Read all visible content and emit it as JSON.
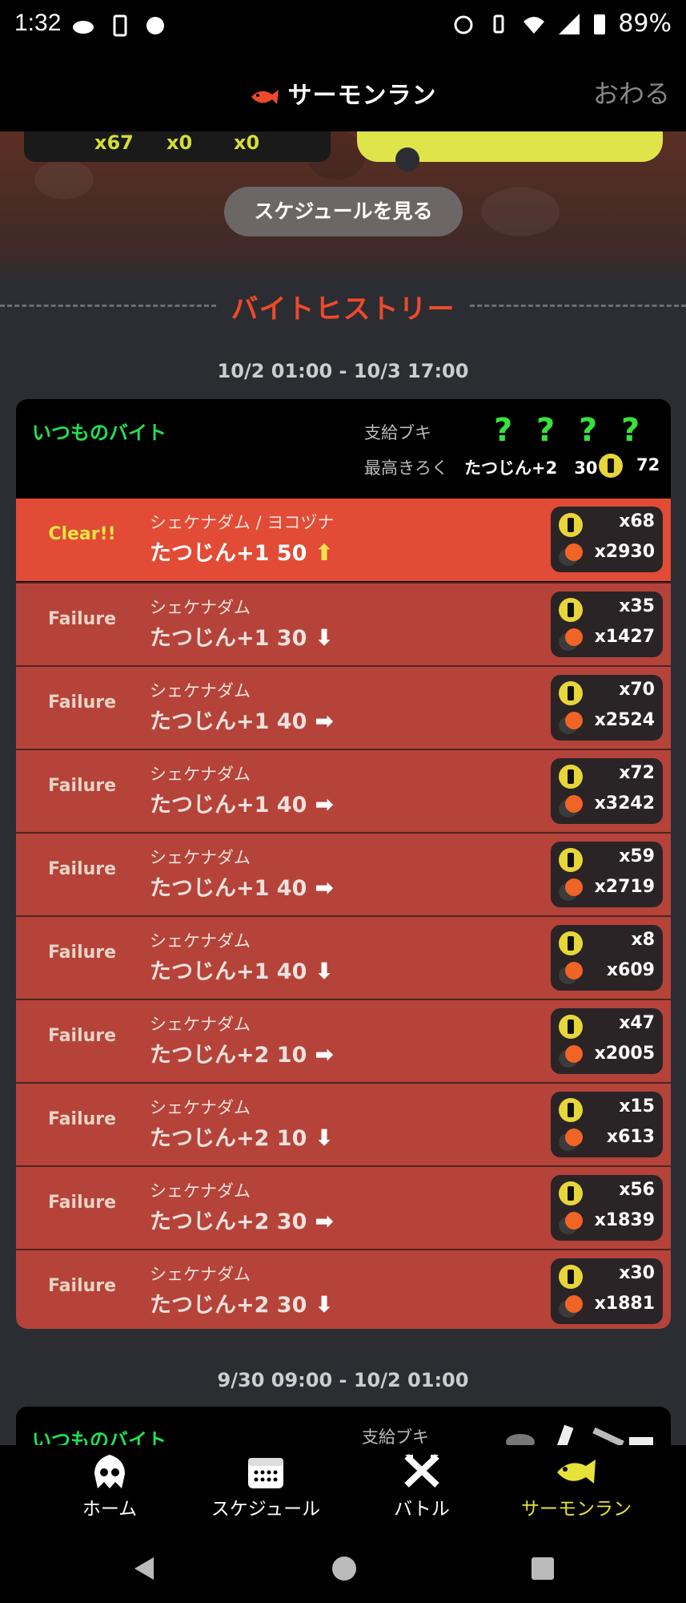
{
  "status_bar": {
    "time": "1:32",
    "battery": "89%",
    "icons_left": [
      "cloud-icon",
      "phone-icon",
      "splat-icon"
    ],
    "icons_right": [
      "alarm-icon",
      "vibrate-icon",
      "wifi-icon",
      "signal-icon",
      "battery-icon"
    ]
  },
  "header": {
    "title": "サーモンラン",
    "close_label": "おわる"
  },
  "hero": {
    "stats": [
      "x67",
      "x0",
      "x0"
    ],
    "schedule_button": "スケジュールを見る"
  },
  "history": {
    "heading": "バイトヒストリー",
    "groups": [
      {
        "range": "10/2 01:00 - 10/3 17:00",
        "job_type": "いつものバイト",
        "weapons_label": "支給ブキ",
        "weapons": [
          "?",
          "?",
          "?",
          "?"
        ],
        "best_label": "最高きろく",
        "best_grade": "たつじん+2　30",
        "best_golden": "72",
        "rows": [
          {
            "result": "Clear!!",
            "stage": "シェケナダム / ヨコヅナ",
            "grade": "たつじん+1 50",
            "trend": "up",
            "golden": "x68",
            "power": "x2930"
          },
          {
            "result": "Failure",
            "stage": "シェケナダム",
            "grade": "たつじん+1 30",
            "trend": "down",
            "golden": "x35",
            "power": "x1427"
          },
          {
            "result": "Failure",
            "stage": "シェケナダム",
            "grade": "たつじん+1 40",
            "trend": "same",
            "golden": "x70",
            "power": "x2524"
          },
          {
            "result": "Failure",
            "stage": "シェケナダム",
            "grade": "たつじん+1 40",
            "trend": "same",
            "golden": "x72",
            "power": "x3242"
          },
          {
            "result": "Failure",
            "stage": "シェケナダム",
            "grade": "たつじん+1 40",
            "trend": "same",
            "golden": "x59",
            "power": "x2719"
          },
          {
            "result": "Failure",
            "stage": "シェケナダム",
            "grade": "たつじん+1 40",
            "trend": "down",
            "golden": "x8",
            "power": "x609"
          },
          {
            "result": "Failure",
            "stage": "シェケナダム",
            "grade": "たつじん+2 10",
            "trend": "same",
            "golden": "x47",
            "power": "x2005"
          },
          {
            "result": "Failure",
            "stage": "シェケナダム",
            "grade": "たつじん+2 10",
            "trend": "down",
            "golden": "x15",
            "power": "x613"
          },
          {
            "result": "Failure",
            "stage": "シェケナダム",
            "grade": "たつじん+2 30",
            "trend": "same",
            "golden": "x56",
            "power": "x1839"
          },
          {
            "result": "Failure",
            "stage": "シェケナダム",
            "grade": "たつじん+2 30",
            "trend": "down",
            "golden": "x30",
            "power": "x1881"
          }
        ]
      },
      {
        "range": "9/30 09:00 - 10/2 01:00",
        "job_type": "いつものバイト",
        "weapons_label": "支給ブキ"
      }
    ]
  },
  "bottom_nav": [
    {
      "label": "ホーム",
      "icon": "squid-home-icon",
      "active": false
    },
    {
      "label": "スケジュール",
      "icon": "calendar-icon",
      "active": false
    },
    {
      "label": "バトル",
      "icon": "crossed-weapons-icon",
      "active": false
    },
    {
      "label": "サーモンラン",
      "icon": "salmon-icon",
      "active": true
    }
  ],
  "colors": {
    "accent_green": "#22e14e",
    "accent_yellow": "#e6e23a",
    "clear_red": "#e24b35",
    "failure_red": "#b5433a",
    "heading_orange": "#ee4a2a"
  }
}
